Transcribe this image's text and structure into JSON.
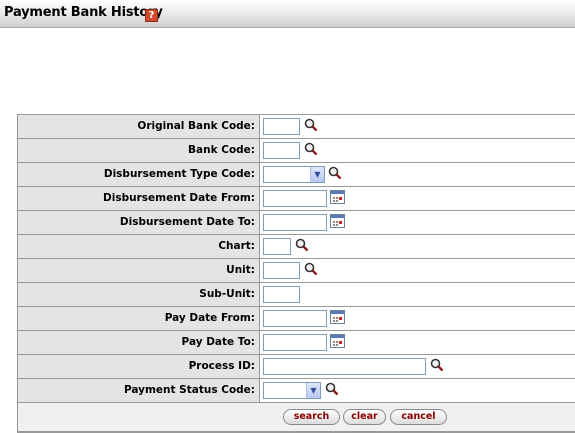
{
  "header": {
    "title": "Payment Bank History",
    "help_icon": "help-icon",
    "help_glyph": "?"
  },
  "form": {
    "fields": [
      {
        "label": "Original Bank Code:",
        "type": "text",
        "value": "",
        "lookup": true
      },
      {
        "label": "Bank Code:",
        "type": "text",
        "value": "",
        "lookup": true
      },
      {
        "label": "Disbursement Type Code:",
        "type": "select",
        "value": "",
        "lookup": true
      },
      {
        "label": "Disbursement Date From:",
        "type": "date",
        "value": ""
      },
      {
        "label": "Disbursement Date To:",
        "type": "date",
        "value": ""
      },
      {
        "label": "Chart:",
        "type": "text",
        "value": "",
        "lookup": true
      },
      {
        "label": "Unit:",
        "type": "text",
        "value": "",
        "lookup": true
      },
      {
        "label": "Sub-Unit:",
        "type": "text",
        "value": ""
      },
      {
        "label": "Pay Date From:",
        "type": "date",
        "value": ""
      },
      {
        "label": "Pay Date To:",
        "type": "date",
        "value": ""
      },
      {
        "label": "Process ID:",
        "type": "text",
        "value": "",
        "lookup": true
      },
      {
        "label": "Payment Status Code:",
        "type": "select",
        "value": "",
        "lookup": true
      }
    ],
    "buttons": {
      "search": "search",
      "clear": "clear",
      "cancel": "cancel"
    }
  },
  "colors": {
    "label_bg": "#e4e4e4",
    "button_text": "#8b0000",
    "border": "#999999"
  }
}
